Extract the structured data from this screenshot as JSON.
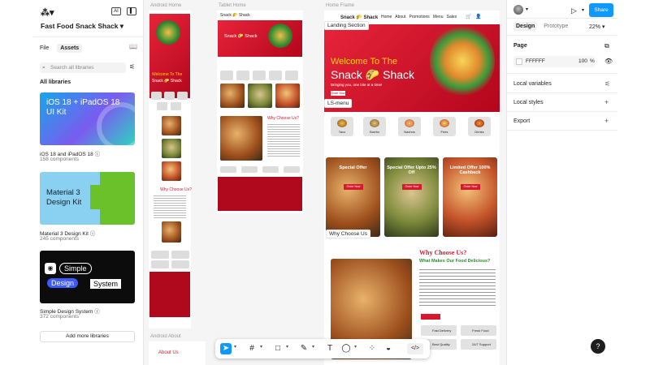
{
  "left_panel": {
    "file_title": "Fast Food Snack Shack",
    "tabs": [
      "File",
      "Assets"
    ],
    "search_placeholder": "Search all libraries",
    "section_title": "All libraries",
    "libraries": [
      {
        "name": "iOS 18 and iPadOS 18",
        "count": "158 components",
        "cover_title": "iOS 18 + iPadOS 18 UI Kit"
      },
      {
        "name": "Material 3 Design Kit",
        "count": "245 components",
        "cover_title": "Material 3 Design Kit"
      },
      {
        "name": "Simple Design System",
        "count": "372 components",
        "cover_words": [
          "Simple",
          "Design",
          "System"
        ]
      }
    ],
    "add_more_label": "Add more libraries"
  },
  "canvas": {
    "frame_labels": {
      "android_home": "Android Home",
      "tablet_home": "Tablet Home",
      "home_frame": "Home Frame",
      "android_about": "Android About"
    },
    "landing_tag": "Landing Section",
    "ls_menu_tag": "LS-menu",
    "why_choose_tag": "Why Choose Us",
    "hero_welcome": "Welcome To The",
    "hero_brand": "Snack 🌮 Shack",
    "hero_sub": "Bringing you, one bite at a time!",
    "brand_small": "Snack 🌮 Shack",
    "nav_items": [
      "Home",
      "About",
      "Promotions",
      "Menu",
      "Sales"
    ],
    "menu_items": [
      "Taco",
      "Burrito",
      "Nachos",
      "Fries",
      "Drinks"
    ],
    "offer_titles": [
      "Special Offer",
      "Special Offer Upto 25% Off",
      "Limited Offer 100% Cashback"
    ],
    "order_label": "Order Now",
    "why_heading": "Why Choose Us?",
    "why_sub": "What Makes Our Food Delicious?",
    "features": [
      "Fast Delivery",
      "Fresh Food",
      "Best Quality",
      "24/7 Support"
    ],
    "tablet_why": "Why Choose Us?",
    "about_heading": "About Us"
  },
  "right_panel": {
    "tabs": [
      "Design",
      "Prototype"
    ],
    "zoom": "22%",
    "share_label": "Share",
    "page_title": "Page",
    "page_color": "FFFFFF",
    "page_opacity": "100",
    "page_opacity_unit": "%",
    "sections": [
      "Local variables",
      "Local styles",
      "Export"
    ]
  },
  "colors": {
    "accent": "#0d99ff",
    "brand_red": "#d9182e"
  }
}
